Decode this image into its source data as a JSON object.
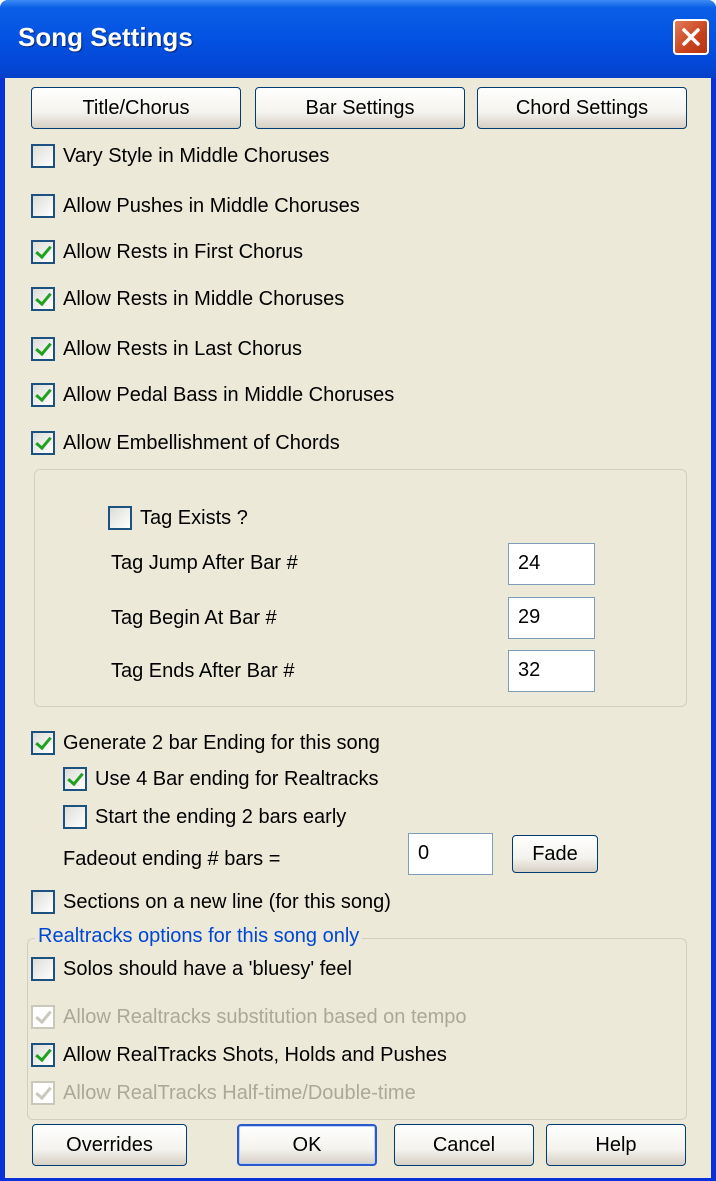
{
  "window": {
    "title": "Song Settings"
  },
  "top_buttons": {
    "title_chorus": "Title/Chorus",
    "bar_settings": "Bar Settings",
    "chord_settings": "Chord Settings"
  },
  "options": [
    {
      "label": "Vary Style in Middle Choruses",
      "checked": false
    },
    {
      "label": "Allow Pushes in Middle Choruses",
      "checked": false
    },
    {
      "label": "Allow Rests in First Chorus",
      "checked": true
    },
    {
      "label": "Allow Rests in Middle Choruses",
      "checked": true
    },
    {
      "label": "Allow Rests in Last Chorus",
      "checked": true
    },
    {
      "label": "Allow Pedal Bass in Middle Choruses",
      "checked": true
    },
    {
      "label": "Allow Embellishment of Chords",
      "checked": true
    }
  ],
  "tag": {
    "exists_label": "Tag Exists ?",
    "exists_checked": false,
    "jump_label": "Tag Jump After Bar #",
    "jump_value": "24",
    "begin_label": "Tag Begin At Bar #",
    "begin_value": "29",
    "ends_label": "Tag Ends After Bar #",
    "ends_value": "32"
  },
  "ending": {
    "generate_label": "Generate 2 bar Ending for this song",
    "generate_checked": true,
    "use4_label": "Use 4 Bar ending for Realtracks",
    "use4_checked": true,
    "start_early_label": "Start the ending 2 bars early",
    "start_early_checked": false,
    "fadeout_label": "Fadeout ending # bars =",
    "fadeout_value": "0",
    "fade_button": "Fade"
  },
  "sections": {
    "label": "Sections on a new line (for this song)",
    "checked": false
  },
  "realtracks": {
    "legend": "Realtracks options for this song only",
    "items": [
      {
        "label": "Solos should have a 'bluesy' feel",
        "checked": false,
        "disabled": false
      },
      {
        "label": "Allow Realtracks substitution based on tempo",
        "checked": true,
        "disabled": true
      },
      {
        "label": "Allow RealTracks Shots, Holds and Pushes",
        "checked": true,
        "disabled": false
      },
      {
        "label": "Allow RealTracks Half-time/Double-time",
        "checked": true,
        "disabled": true
      }
    ]
  },
  "bottom_buttons": {
    "overrides": "Overrides",
    "ok": "OK",
    "cancel": "Cancel",
    "help": "Help"
  },
  "colors": {
    "titlebar": "#0554e4",
    "face": "#ece9d8",
    "legend": "#0046d5",
    "check": "#21a121",
    "close": "#c8421c"
  }
}
